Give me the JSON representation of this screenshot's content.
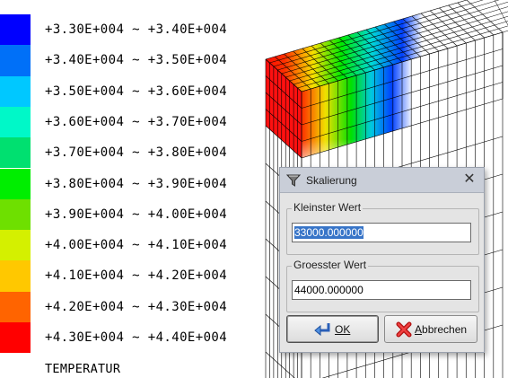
{
  "legend": {
    "rows": [
      {
        "label": "+3.30E+004 ~ +3.40E+004",
        "color": "#0000ff"
      },
      {
        "label": "+3.40E+004 ~ +3.50E+004",
        "color": "#0070f8"
      },
      {
        "label": "+3.50E+004 ~ +3.60E+004",
        "color": "#00c8ff"
      },
      {
        "label": "+3.60E+004 ~ +3.70E+004",
        "color": "#00f8c8"
      },
      {
        "label": "+3.70E+004 ~ +3.80E+004",
        "color": "#00e070"
      },
      {
        "label": "+3.80E+004 ~ +3.90E+004",
        "color": "#00ee00"
      },
      {
        "label": "+3.90E+004 ~ +4.00E+004",
        "color": "#6ee000"
      },
      {
        "label": "+4.00E+004 ~ +4.10E+004",
        "color": "#d4f000"
      },
      {
        "label": "+4.10E+004 ~ +4.20E+004",
        "color": "#ffc800"
      },
      {
        "label": "+4.20E+004 ~ +4.30E+004",
        "color": "#ff6400"
      },
      {
        "label": "+4.30E+004 ~ +4.40E+004",
        "color": "#ff0000"
      }
    ],
    "title": "TEMPERATUR"
  },
  "dialog": {
    "title": "Skalierung",
    "icon": "funnel-icon",
    "close_symbol": "✕",
    "min_group_label": "Kleinster Wert",
    "min_value": "33000.000000",
    "max_group_label": "Groesster Wert",
    "max_value": "44000.000000",
    "ok_label": "OK",
    "cancel_label": "Abbrechen"
  }
}
